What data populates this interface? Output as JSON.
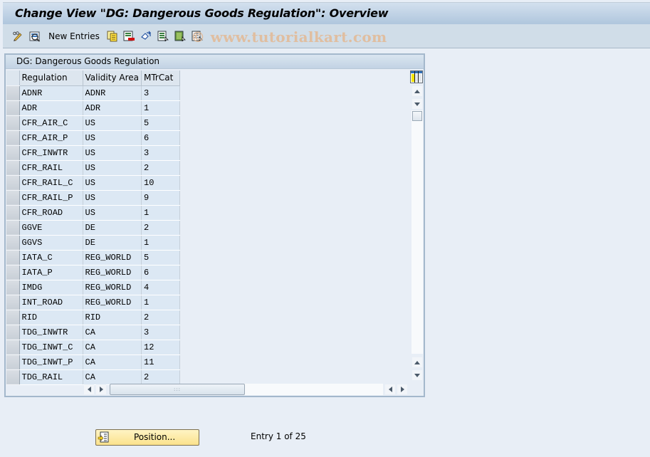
{
  "window": {
    "title": "Change View \"DG: Dangerous Goods Regulation\": Overview"
  },
  "toolbar": {
    "buttons": [
      {
        "name": "display-change-icon",
        "label": ""
      },
      {
        "name": "details-icon",
        "label": ""
      },
      {
        "name": "new-entries",
        "label": "New Entries"
      },
      {
        "name": "copy-as-icon",
        "label": ""
      },
      {
        "name": "delete-icon",
        "label": ""
      },
      {
        "name": "undo-change-icon",
        "label": ""
      },
      {
        "name": "select-all-icon",
        "label": ""
      },
      {
        "name": "select-block-icon",
        "label": ""
      },
      {
        "name": "deselect-all-icon",
        "label": ""
      }
    ],
    "watermark": "© www.tutorialkart.com"
  },
  "table": {
    "title": "DG: Dangerous Goods Regulation",
    "columns": [
      "Regulation",
      "Validity Area",
      "MTrCat"
    ],
    "rows": [
      [
        "ADNR",
        "ADNR",
        "3"
      ],
      [
        "ADR",
        "ADR",
        "1"
      ],
      [
        "CFR_AIR_C",
        "US",
        "5"
      ],
      [
        "CFR_AIR_P",
        "US",
        "6"
      ],
      [
        "CFR_INWTR",
        "US",
        "3"
      ],
      [
        "CFR_RAIL",
        "US",
        "2"
      ],
      [
        "CFR_RAIL_C",
        "US",
        "10"
      ],
      [
        "CFR_RAIL_P",
        "US",
        "9"
      ],
      [
        "CFR_ROAD",
        "US",
        "1"
      ],
      [
        "GGVE",
        "DE",
        "2"
      ],
      [
        "GGVS",
        "DE",
        "1"
      ],
      [
        "IATA_C",
        "REG_WORLD",
        "5"
      ],
      [
        "IATA_P",
        "REG_WORLD",
        "6"
      ],
      [
        "IMDG",
        "REG_WORLD",
        "4"
      ],
      [
        "INT_ROAD",
        "REG_WORLD",
        "1"
      ],
      [
        "RID",
        "RID",
        "2"
      ],
      [
        "TDG_INWTR",
        "CA",
        "3"
      ],
      [
        "TDG_INWT_C",
        "CA",
        "12"
      ],
      [
        "TDG_INWT_P",
        "CA",
        "11"
      ],
      [
        "TDG_RAIL",
        "CA",
        "2"
      ]
    ],
    "hscroll_grip": ":::"
  },
  "footer": {
    "position_label": "Position...",
    "entry_info": "Entry 1 of 25"
  }
}
